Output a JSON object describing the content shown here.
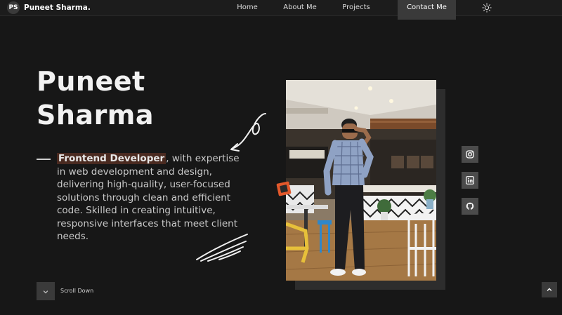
{
  "nav": {
    "logo_mark": "PS",
    "logo_text": "Puneet Sharma.",
    "links": [
      "Home",
      "About Me",
      "Projects"
    ],
    "contact": "Contact Me",
    "theme_icon": "sun-icon"
  },
  "hero": {
    "name_line1": "Puneet",
    "name_line2": "Sharma",
    "role": "Frontend Developer",
    "description": ", with expertise in web development and design, delivering high-quality, user-focused solutions through clean and efficient code. Skilled in creating intuitive, responsive interfaces that meet client needs."
  },
  "socials": [
    "instagram-icon",
    "linkedin-icon",
    "github-icon"
  ],
  "scroll": {
    "label": "Scroll Down"
  },
  "colors": {
    "background": "#171717",
    "accent": "#e2582b",
    "role_highlight": "#4a2a20"
  }
}
